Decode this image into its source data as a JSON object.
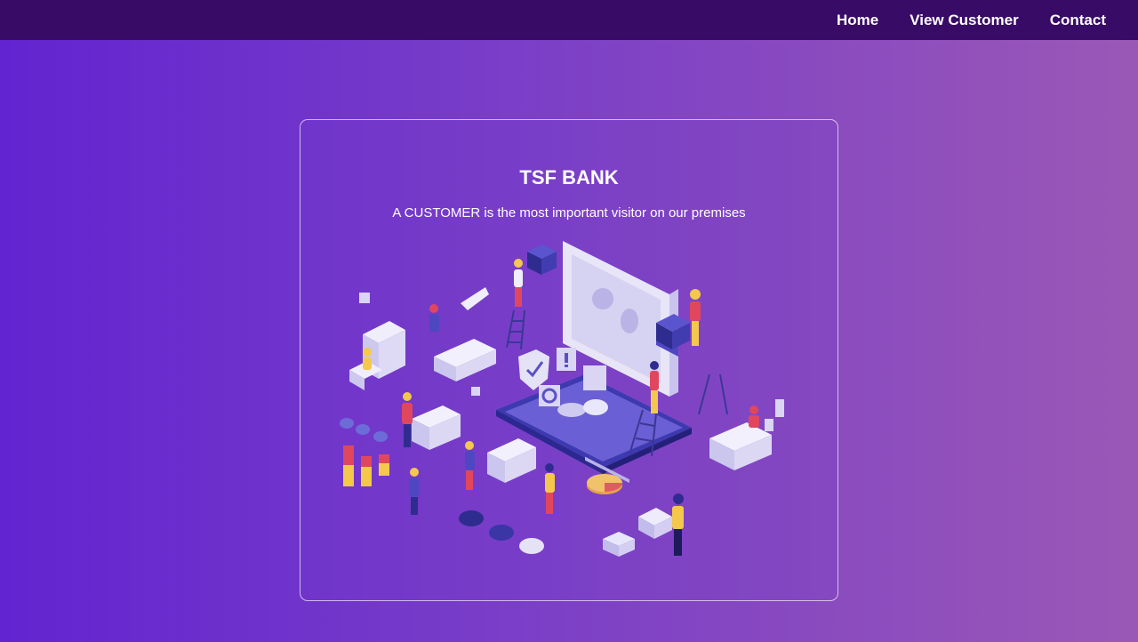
{
  "nav": {
    "items": [
      {
        "label": "Home"
      },
      {
        "label": "View Customer"
      },
      {
        "label": "Contact"
      }
    ]
  },
  "hero": {
    "title": "TSF BANK",
    "subtitle": "A CUSTOMER is the most important visitor on our premises",
    "illustration": "isometric-bank-office-illustration"
  },
  "colors": {
    "navbar": "#380c66",
    "gradient_start": "#6224d0",
    "gradient_end": "#9a58b6",
    "text": "#ffffff"
  }
}
